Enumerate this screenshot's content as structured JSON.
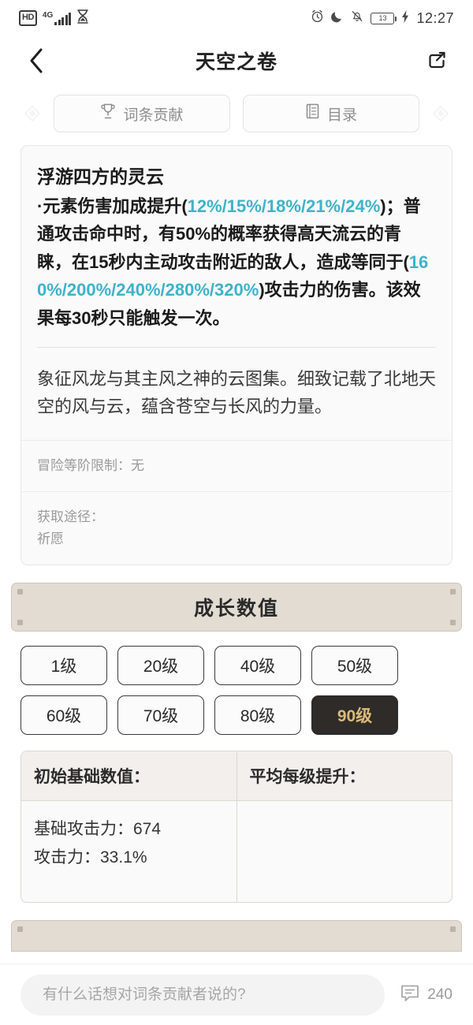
{
  "status_bar": {
    "hd_label": "HD",
    "network_label": "4G",
    "icons": [
      "hd-icon",
      "signal-bars-icon",
      "hourglass-icon",
      "alarm-clock-icon",
      "moon-icon",
      "bell-muted-icon",
      "battery-icon",
      "charging-bolt-icon"
    ],
    "battery_level": "13",
    "time": "12:27"
  },
  "nav": {
    "back_icon": "chevron-left-icon",
    "title": "天空之卷",
    "share_icon": "share-icon"
  },
  "tabs": {
    "left_ornament": "diamond-ornament-icon",
    "right_ornament": "diamond-ornament-icon",
    "items": [
      {
        "label": "词条贡献",
        "icon": "trophy-icon"
      },
      {
        "label": "目录",
        "icon": "list-document-icon"
      }
    ]
  },
  "info_card": {
    "skill_title": "浮游四方的灵云",
    "skill_text": {
      "p1": "·元素伤害加成提升(",
      "v1": "12%/15%/18%/21%/24%",
      "p2": ")；普通攻击命中时，有50%的概率获得高天流云的青睐，在15秒内主动攻击附近的敌人，造成等同于(",
      "v2": "160%/200%/240%/280%/320%",
      "p3": ")攻击力的伤害。该效果每30秒只能触发一次。"
    },
    "flavor_text": "象征风龙与其主风之神的云图集。细致记载了北地天空的风与云，蕴含苍空与长风的力量。",
    "rows": [
      {
        "label": "冒险等阶限制：无"
      },
      {
        "label": "获取途径：",
        "value": "祈愿"
      }
    ]
  },
  "stats_panel": {
    "title": "成长数值",
    "levels": [
      {
        "label": "1级",
        "selected": false
      },
      {
        "label": "20级",
        "selected": false
      },
      {
        "label": "40级",
        "selected": false
      },
      {
        "label": "50级",
        "selected": false
      },
      {
        "label": "60级",
        "selected": false
      },
      {
        "label": "70级",
        "selected": false
      },
      {
        "label": "80级",
        "selected": false
      },
      {
        "label": "90级",
        "selected": true
      }
    ],
    "table": {
      "headers": [
        "初始基础数值：",
        "平均每级提升："
      ],
      "left_rows": [
        "基础攻击力：674",
        "攻击力：33.1%"
      ],
      "right_rows": []
    }
  },
  "bottom_bar": {
    "comment_placeholder": "有什么话想对词条贡献者说的?",
    "comment_icon": "comment-bubble-icon",
    "comment_count": "240"
  },
  "colors": {
    "highlight": "#3fb3c9",
    "panel_bg": "#e2dcd3",
    "selected_level_bg": "#2e2b28",
    "selected_level_text": "#d9bb7a"
  }
}
